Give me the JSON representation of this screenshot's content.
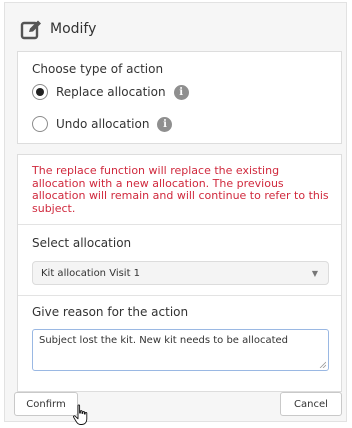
{
  "header": {
    "title": "Modify",
    "icon": "edit-icon"
  },
  "action_type": {
    "label": "Choose type of action",
    "options": [
      {
        "label": "Replace allocation",
        "selected": true,
        "info_icon": "info-icon"
      },
      {
        "label": "Undo allocation",
        "selected": false,
        "info_icon": "info-icon"
      }
    ]
  },
  "warning": {
    "text": "The replace function will replace the existing allocation with a new allocation. The previous allocation will remain and will continue to refer to this subject.",
    "color": "#d0293d"
  },
  "allocation": {
    "label": "Select allocation",
    "selected_value": "Kit allocation Visit 1"
  },
  "reason": {
    "label": "Give reason for the action",
    "value": "Subject lost the kit. New kit needs to be allocated"
  },
  "buttons": {
    "confirm": "Confirm",
    "cancel": "Cancel"
  }
}
